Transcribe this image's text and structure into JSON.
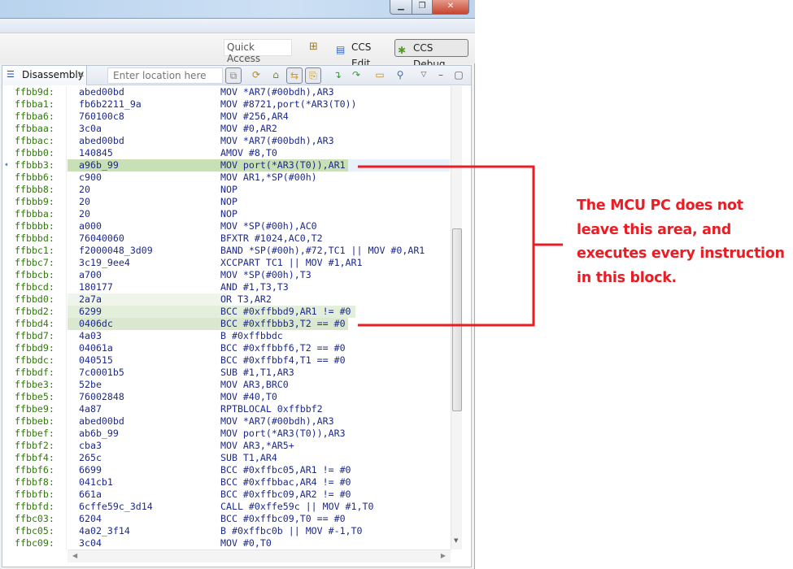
{
  "window": {
    "controls": [
      "minimize",
      "restore",
      "close"
    ]
  },
  "toolbar": {
    "quick_access_placeholder": "Quick Access",
    "perspectives": [
      {
        "label": "CCS Edit",
        "icon": "ccs-edit-icon"
      },
      {
        "label": "CCS Debug",
        "icon": "ccs-debug-icon",
        "active": true
      }
    ]
  },
  "view": {
    "tab_label": "Disassembly",
    "location_placeholder": "Enter location here",
    "toolbar_icons": [
      "link-icon",
      "refresh-icon",
      "home-icon",
      "sync-icon",
      "show-source-icon",
      "step-into-icon",
      "step-over-icon",
      "new-view-icon",
      "pin-icon",
      "view-menu-icon",
      "minimize-icon",
      "maximize-icon"
    ]
  },
  "disassembly": {
    "current_pc": "ffbbb3:",
    "rows": [
      {
        "addr": "ffbb9d:",
        "op": "abed00bd",
        "ins": "MOV *AR7(#00bdh),AR3"
      },
      {
        "addr": "ffbba1:",
        "op": "fb6b2211_9a",
        "ins": "MOV #8721,port(*AR3(T0))"
      },
      {
        "addr": "ffbba6:",
        "op": "760100c8",
        "ins": "MOV #256,AR4"
      },
      {
        "addr": "ffbbaa:",
        "op": "3c0a",
        "ins": "MOV #0,AR2"
      },
      {
        "addr": "ffbbac:",
        "op": "abed00bd",
        "ins": "MOV *AR7(#00bdh),AR3"
      },
      {
        "addr": "ffbbb0:",
        "op": "140845",
        "ins": "AMOV #8,T0"
      },
      {
        "addr": "ffbbb3:",
        "op": "a96b_99",
        "ins": "MOV port(*AR3(T0)),AR1",
        "highlight": "current"
      },
      {
        "addr": "ffbbb6:",
        "op": "c900",
        "ins": "MOV AR1,*SP(#00h)"
      },
      {
        "addr": "ffbbb8:",
        "op": "20",
        "ins": "NOP"
      },
      {
        "addr": "ffbbb9:",
        "op": "20",
        "ins": "NOP"
      },
      {
        "addr": "ffbbba:",
        "op": "20",
        "ins": "NOP"
      },
      {
        "addr": "ffbbbb:",
        "op": "a000",
        "ins": "MOV *SP(#00h),AC0"
      },
      {
        "addr": "ffbbbd:",
        "op": "76040060",
        "ins": "BFXTR #1024,AC0,T2"
      },
      {
        "addr": "ffbbc1:",
        "op": "f2000048_3d09",
        "ins": "BAND *SP(#00h),#72,TC1 || MOV #0,AR1"
      },
      {
        "addr": "ffbbc7:",
        "op": "3c19_9ee4",
        "ins": "XCCPART TC1 || MOV #1,AR1"
      },
      {
        "addr": "ffbbcb:",
        "op": "a700",
        "ins": "MOV *SP(#00h),T3"
      },
      {
        "addr": "ffbbcd:",
        "op": "180177",
        "ins": "AND #1,T3,T3"
      },
      {
        "addr": "ffbbd0:",
        "op": "2a7a",
        "ins": "OR T3,AR2",
        "highlight": "light"
      },
      {
        "addr": "ffbbd2:",
        "op": "6299",
        "ins": "BCC #0xffbbd9,AR1 != #0",
        "highlight": "mid"
      },
      {
        "addr": "ffbbd4:",
        "op": "0406dc",
        "ins": "BCC #0xffbbb3,T2 == #0",
        "highlight": "strong"
      },
      {
        "addr": "ffbbd7:",
        "op": "4a03",
        "ins": "B #0xffbbdc"
      },
      {
        "addr": "ffbbd9:",
        "op": "04061a",
        "ins": "BCC #0xffbbf6,T2 == #0"
      },
      {
        "addr": "ffbbdc:",
        "op": "040515",
        "ins": "BCC #0xffbbf4,T1 == #0"
      },
      {
        "addr": "ffbbdf:",
        "op": "7c0001b5",
        "ins": "SUB #1,T1,AR3"
      },
      {
        "addr": "ffbbe3:",
        "op": "52be",
        "ins": "MOV AR3,BRC0"
      },
      {
        "addr": "ffbbe5:",
        "op": "76002848",
        "ins": "MOV #40,T0"
      },
      {
        "addr": "ffbbe9:",
        "op": "4a87",
        "ins": "RPTBLOCAL 0xffbbf2"
      },
      {
        "addr": "ffbbeb:",
        "op": "abed00bd",
        "ins": "MOV *AR7(#00bdh),AR3"
      },
      {
        "addr": "ffbbef:",
        "op": "ab6b_99",
        "ins": "MOV port(*AR3(T0)),AR3"
      },
      {
        "addr": "ffbbf2:",
        "op": "cba3",
        "ins": "MOV AR3,*AR5+"
      },
      {
        "addr": "ffbbf4:",
        "op": "265c",
        "ins": "SUB T1,AR4"
      },
      {
        "addr": "ffbbf6:",
        "op": "6699",
        "ins": "BCC #0xffbc05,AR1 != #0"
      },
      {
        "addr": "ffbbf8:",
        "op": "041cb1",
        "ins": "BCC #0xffbbac,AR4 != #0"
      },
      {
        "addr": "ffbbfb:",
        "op": "661a",
        "ins": "BCC #0xffbc09,AR2 != #0"
      },
      {
        "addr": "ffbbfd:",
        "op": "6cffe59c_3d14",
        "ins": "CALL #0xffe59c || MOV #1,T0"
      },
      {
        "addr": "ffbc03:",
        "op": "6204",
        "ins": "BCC #0xffbc09,T0 == #0"
      },
      {
        "addr": "ffbc05:",
        "op": "4a02_3f14",
        "ins": "B #0xffbc0b || MOV #-1,T0"
      },
      {
        "addr": "ffbc09:",
        "op": "3c04",
        "ins": "MOV #0,T0"
      }
    ]
  },
  "annotation": {
    "color": "#ec1c24",
    "lines": [
      "The MCU PC does not",
      "leave this area, and",
      "executes every instruction",
      "in this block."
    ]
  }
}
